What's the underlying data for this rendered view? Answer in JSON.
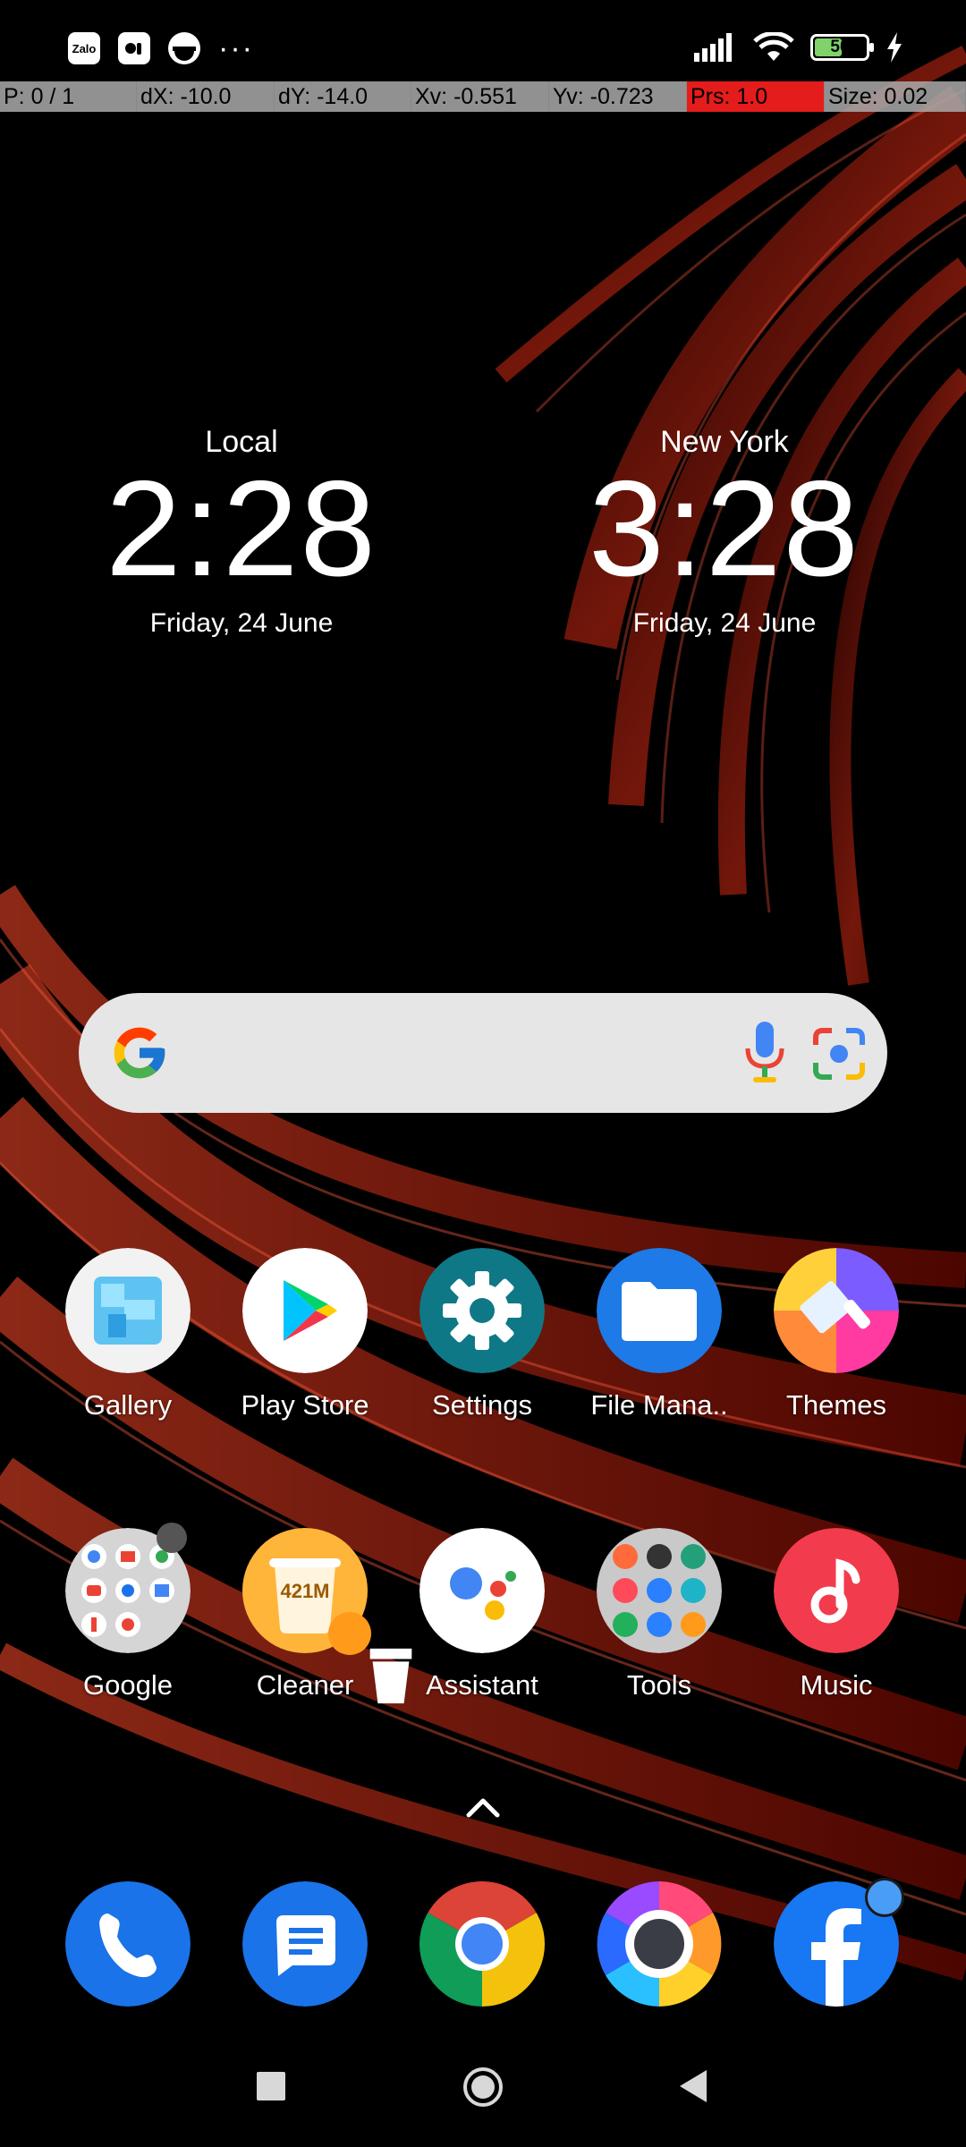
{
  "status_bar": {
    "left_icons": [
      "zalo-icon",
      "messenger-icon",
      "circle-icon",
      "more-dots-icon"
    ],
    "zalo_text": "Zalo",
    "dots": "···",
    "battery_level": "50",
    "right_icons": [
      "signal-icon",
      "wifi-icon",
      "battery-icon",
      "charging-icon"
    ]
  },
  "debug_bar": {
    "pointer": "P: 0 / 1",
    "dx": "dX: -10.0",
    "dy": "dY: -14.0",
    "xv": "Xv: -0.551",
    "yv": "Yv: -0.723",
    "prs": "Prs: 1.0",
    "size": "Size: 0.02"
  },
  "clocks": [
    {
      "city": "Local",
      "time": "2:28",
      "date": "Friday, 24 June"
    },
    {
      "city": "New York",
      "time": "3:28",
      "date": "Friday, 24 June"
    }
  ],
  "search": {
    "icons": [
      "google-g-icon",
      "microphone-icon",
      "lens-icon"
    ]
  },
  "apps_row1": [
    {
      "label": "Gallery"
    },
    {
      "label": "Play Store"
    },
    {
      "label": "Settings"
    },
    {
      "label": "File Mana.."
    },
    {
      "label": "Themes"
    }
  ],
  "apps_row2": [
    {
      "label": "Google"
    },
    {
      "label": "Cleaner",
      "icon_text": "421M"
    },
    {
      "label": "Assistant"
    },
    {
      "label": "Tools"
    },
    {
      "label": "Music"
    }
  ],
  "dock": [
    "phone-icon",
    "messages-icon",
    "chrome-icon",
    "camera-icon",
    "facebook-icon"
  ],
  "navbar": [
    "recents-button",
    "home-button",
    "back-button"
  ],
  "colors": {
    "accent_red": "#e51c1c",
    "search_bg": "#e6e6e6"
  }
}
